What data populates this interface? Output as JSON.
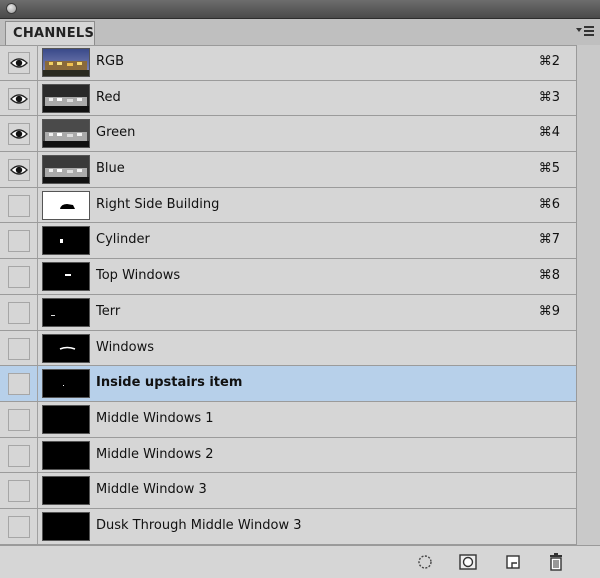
{
  "panel": {
    "tab_label": "CHANNELS"
  },
  "channels": [
    {
      "label": "RGB",
      "shortcut": "⌘2",
      "visible": true,
      "thumb": "rgb-thumbnail"
    },
    {
      "label": "Red",
      "shortcut": "⌘3",
      "visible": true,
      "thumb": "grayscale-thumbnail"
    },
    {
      "label": "Green",
      "shortcut": "⌘4",
      "visible": true,
      "thumb": "grayscale-thumbnail"
    },
    {
      "label": "Blue",
      "shortcut": "⌘5",
      "visible": true,
      "thumb": "grayscale-thumbnail"
    },
    {
      "label": "Right Side Building",
      "shortcut": "⌘6",
      "visible": false,
      "thumb": "mask-thumbnail"
    },
    {
      "label": "Cylinder",
      "shortcut": "⌘7",
      "visible": false,
      "thumb": "mask-thumbnail"
    },
    {
      "label": "Top Windows",
      "shortcut": "⌘8",
      "visible": false,
      "thumb": "mask-thumbnail"
    },
    {
      "label": "Terr",
      "shortcut": "⌘9",
      "visible": false,
      "thumb": "mask-thumbnail"
    },
    {
      "label": "Windows",
      "shortcut": "",
      "visible": false,
      "thumb": "mask-thumbnail"
    },
    {
      "label": "Inside upstairs item",
      "shortcut": "",
      "visible": false,
      "thumb": "mask-thumbnail",
      "selected": true
    },
    {
      "label": "Middle Windows 1",
      "shortcut": "",
      "visible": false,
      "thumb": "mask-thumbnail"
    },
    {
      "label": "Middle Windows 2",
      "shortcut": "",
      "visible": false,
      "thumb": "mask-thumbnail"
    },
    {
      "label": "Middle Window 3",
      "shortcut": "",
      "visible": false,
      "thumb": "mask-thumbnail"
    },
    {
      "label": "Dusk Through Middle Window 3",
      "shortcut": "",
      "visible": false,
      "thumb": "mask-thumbnail"
    }
  ],
  "bottom_icons": [
    "load-channel-as-selection-icon",
    "save-selection-as-channel-icon",
    "new-channel-icon",
    "delete-channel-icon"
  ],
  "colors": {
    "selected_row": "#b7d0ea",
    "panel_bg": "#d6d6d6"
  }
}
